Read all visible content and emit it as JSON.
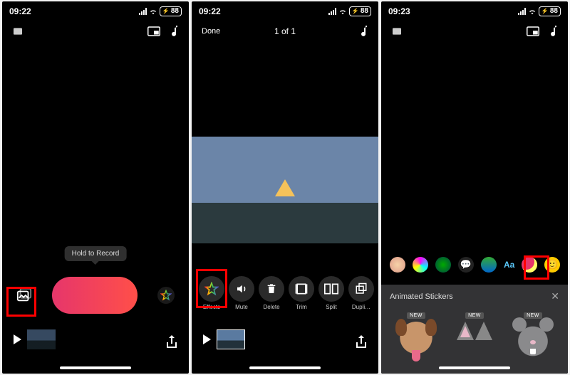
{
  "panel1": {
    "status": {
      "time": "09:22",
      "battery": "88"
    },
    "tooltip": "Hold to Record",
    "icons": {
      "project": "project-icon",
      "aspect": "aspect-icon",
      "music": "music-icon",
      "library": "photo-library-icon",
      "effects": "star-icon",
      "play": "play-icon",
      "share": "share-icon"
    }
  },
  "panel2": {
    "status": {
      "time": "09:22",
      "battery": "88"
    },
    "done": "Done",
    "counter": "1 of 1",
    "editbar": [
      {
        "id": "effects",
        "label": "Effects"
      },
      {
        "id": "mute",
        "label": "Mute"
      },
      {
        "id": "delete",
        "label": "Delete"
      },
      {
        "id": "trim",
        "label": "Trim"
      },
      {
        "id": "split",
        "label": "Split"
      },
      {
        "id": "dupli",
        "label": "Dupli…"
      }
    ]
  },
  "panel3": {
    "status": {
      "time": "09:23",
      "battery": "88"
    },
    "fx": {
      "aa": "Aa"
    },
    "sticker_header": "Animated Stickers",
    "stickers": [
      {
        "id": "dog",
        "badge": "NEW"
      },
      {
        "id": "cat",
        "badge": "NEW"
      },
      {
        "id": "mouse",
        "badge": "NEW"
      }
    ]
  }
}
